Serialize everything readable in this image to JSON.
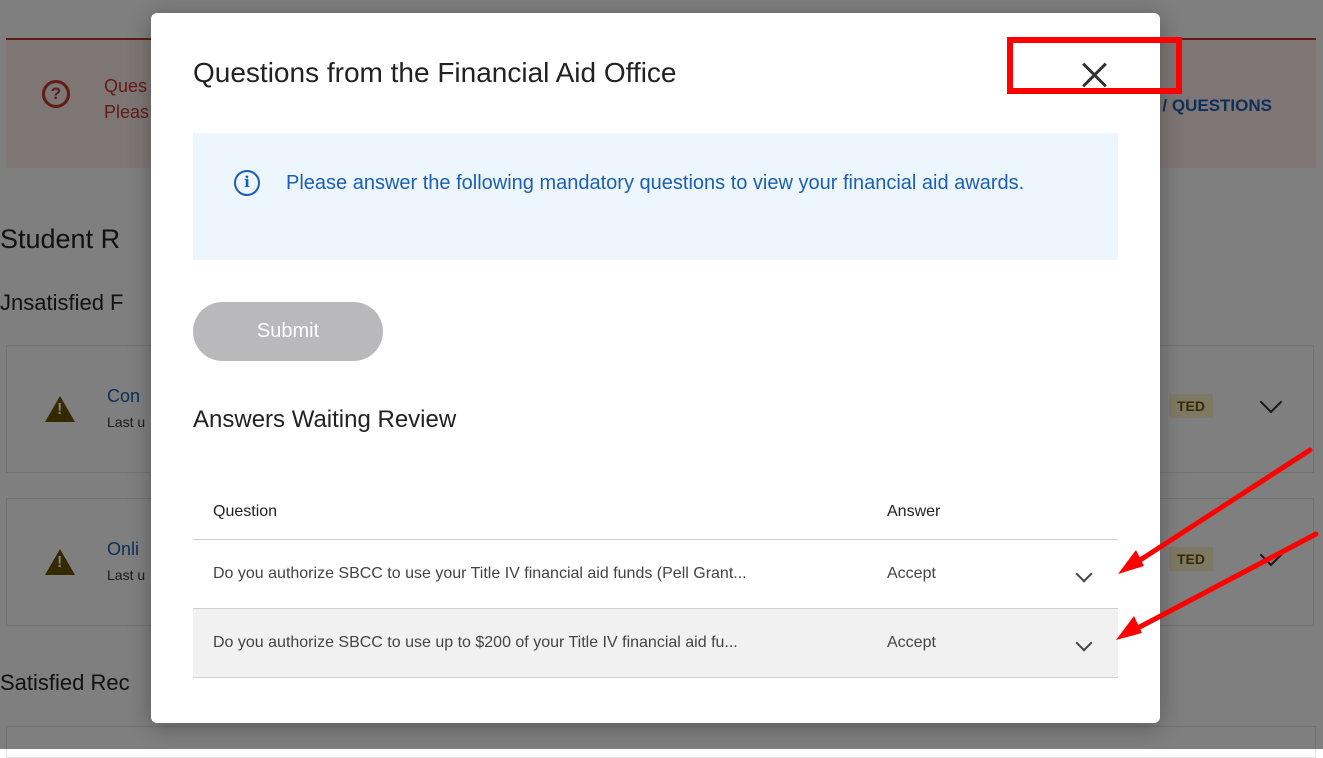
{
  "background": {
    "alert_title": "Ques",
    "alert_sub": "Pleas",
    "alert_link": "/ QUESTIONS",
    "page_heading": "Student R",
    "unsatisfied_heading": "Jnsatisfied F",
    "satisfied_heading": "Satisfied Rec",
    "cards": [
      {
        "title": "Con",
        "sub": "Last u",
        "badge": "TED"
      },
      {
        "title": "Onli",
        "sub": "Last u",
        "badge": "TED"
      }
    ]
  },
  "modal": {
    "title": "Questions from the Financial Aid Office",
    "close_icon": "close-icon",
    "info_icon": "info-icon",
    "info_text": "Please answer the following mandatory questions to view your financial aid awards.",
    "submit_label": "Submit",
    "section_title": "Answers Waiting Review",
    "table": {
      "headers": {
        "question": "Question",
        "answer": "Answer"
      },
      "rows": [
        {
          "question": "Do you authorize SBCC to use your Title IV financial aid funds (Pell Grant...",
          "answer": "Accept"
        },
        {
          "question": "Do you authorize SBCC to use up to $200 of your Title IV financial aid fu...",
          "answer": "Accept"
        }
      ]
    }
  },
  "colors": {
    "accent": "#1a5fb4",
    "annotation": "#ff0000",
    "submit_disabled": "#b9b9bc",
    "alert": "#c0392b"
  }
}
